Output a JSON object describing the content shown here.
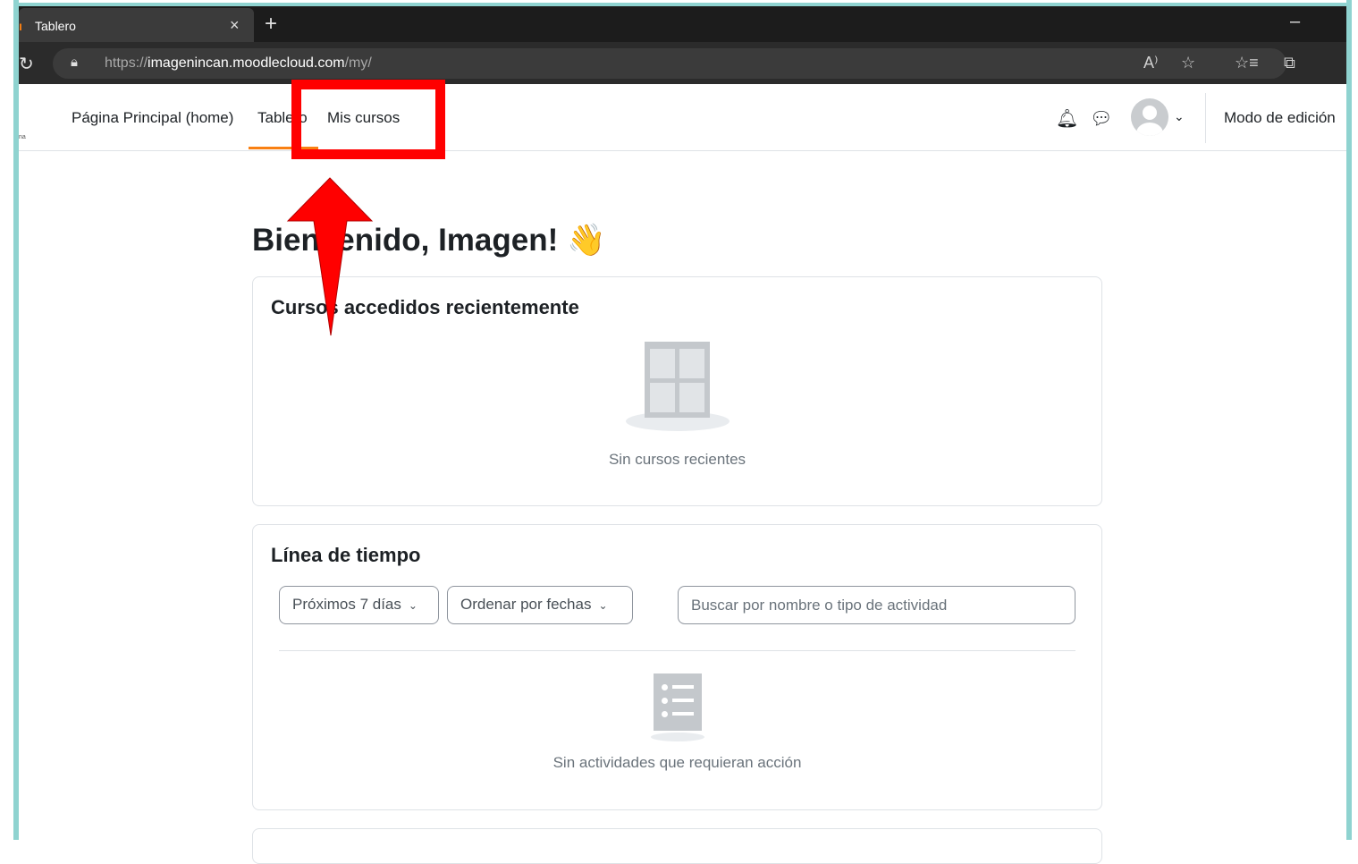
{
  "browser": {
    "tab_title": "Tablero",
    "tab_favicon": "moodle-favicon",
    "tab_close": "×",
    "new_tab": "+",
    "minimize": "–",
    "url_prefix": "https://",
    "url_host": "imagenincan.moodlecloud.com",
    "url_path": "/my/",
    "read_aloud": "A)",
    "favorites": "☆",
    "favorites_list": "☆≡",
    "collections": "⧉"
  },
  "navbar": {
    "logo_fragment": "na",
    "items": [
      {
        "label": "Página Principal (home)"
      },
      {
        "label": "Tablero"
      },
      {
        "label": "Mis cursos"
      }
    ],
    "edit_mode_label": "Modo de edición"
  },
  "main": {
    "welcome": "Bienvenido, Imagen! 👋",
    "recent": {
      "title": "Cursos accedidos recientemente",
      "empty": "Sin cursos recientes"
    },
    "timeline": {
      "title": "Línea de tiempo",
      "filter_days": "Próximos 7 días",
      "sort": "Ordenar por fechas",
      "search_placeholder": "Buscar por nombre o tipo de actividad",
      "empty": "Sin actividades que requieran acción"
    }
  },
  "annotation": {
    "color": "#ff0000",
    "target": "Mis cursos"
  },
  "colors": {
    "accent": "#f98012",
    "frame": "#8fd3d0",
    "annotation": "#ff0000"
  }
}
